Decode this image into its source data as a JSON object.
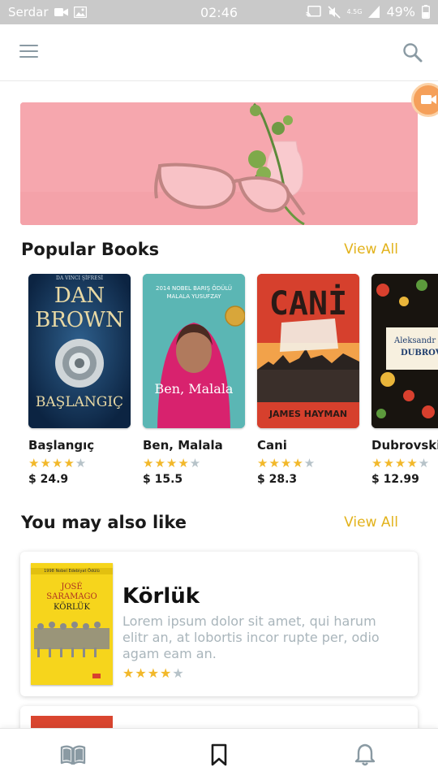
{
  "status_bar": {
    "carrier": "Serdar",
    "time": "02:46",
    "network": "4.5G",
    "battery": "49%"
  },
  "app_bar": {
    "menu_icon": "hamburger-menu-icon",
    "search_icon": "search-icon"
  },
  "popular": {
    "title": "Popular Books",
    "view_all": "View All",
    "books": [
      {
        "title": "Başlangıç",
        "price": "$ 24.9",
        "rating": 4,
        "cover": {
          "top_line": "DA VINCI ŞİFRESİ",
          "author_1": "DAN",
          "author_2": "BROWN",
          "cover_title": "BAŞLANGIÇ"
        }
      },
      {
        "title": "Ben, Malala",
        "price": "$ 15.5",
        "rating": 4,
        "cover": {
          "award": "2014 NOBEL BARIŞ ÖDÜLÜ",
          "author": "MALALA YUSUFZAY",
          "cover_title": "Ben, Malala"
        }
      },
      {
        "title": "Cani",
        "price": "$ 28.3",
        "rating": 4,
        "cover": {
          "cover_title": "CANİ",
          "author": "JAMES HAYMAN"
        }
      },
      {
        "title": "Dubrovski",
        "price": "$ 12.99",
        "rating": 4,
        "cover": {
          "author": "Aleksandr Pu",
          "cover_title": "DUBROVS"
        }
      }
    ]
  },
  "also_like": {
    "title": "You may also like",
    "view_all": "View All",
    "items": [
      {
        "title": "Körlük",
        "description": "Lorem ipsum dolor sit amet, qui harum elitr an, at lobortis incor rupte per, odio agam eam an.",
        "rating": 4,
        "cover": {
          "award": "1998 Nobel Edebiyat Ödülü",
          "author_1": "JOSÉ",
          "author_2": "SARAMAGO",
          "cover_title": "KÖRLÜK"
        }
      }
    ]
  },
  "bottom_nav": {
    "items": [
      "book-open-icon",
      "bookmark-icon",
      "bell-icon"
    ]
  },
  "colors": {
    "accent": "#e2b21b",
    "star": "#f2b82a",
    "star_off": "#b7c3c9",
    "banner": "#f6a7ae"
  }
}
